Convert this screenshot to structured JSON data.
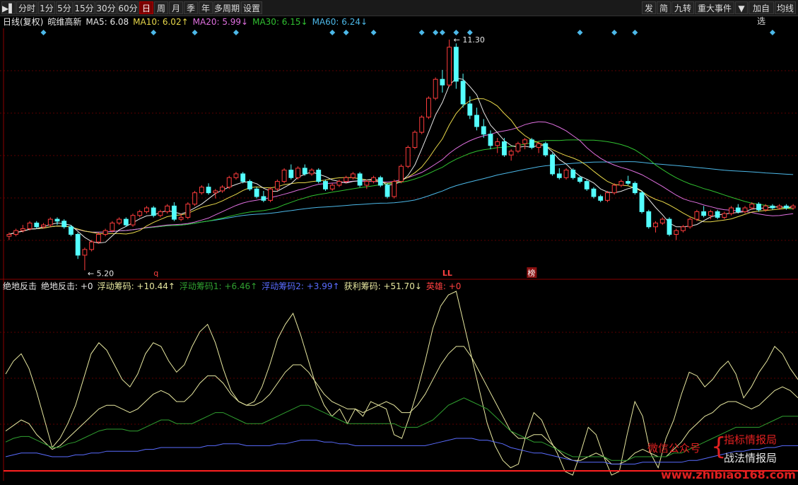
{
  "toolbar": {
    "left": [
      {
        "key": "play",
        "label": "▶▌"
      },
      {
        "key": "fenshi",
        "label": "分时"
      },
      {
        "key": "1f",
        "label": "1分"
      },
      {
        "key": "5f",
        "label": "5分"
      },
      {
        "key": "15f",
        "label": "15分"
      },
      {
        "key": "30f",
        "label": "30分"
      },
      {
        "key": "60f",
        "label": "60分"
      },
      {
        "key": "day",
        "label": "日",
        "active": true
      },
      {
        "key": "week",
        "label": "周"
      },
      {
        "key": "month",
        "label": "月"
      },
      {
        "key": "season",
        "label": "季"
      },
      {
        "key": "year",
        "label": "年"
      },
      {
        "key": "multi",
        "label": "多周期"
      },
      {
        "key": "settings",
        "label": "设置"
      }
    ],
    "right": [
      {
        "key": "fa",
        "label": "发"
      },
      {
        "key": "jian",
        "label": "简"
      },
      {
        "key": "jiuzhuan",
        "label": "九转"
      },
      {
        "key": "event",
        "label": "重大事件"
      },
      {
        "key": "dropdown",
        "label": "▼"
      },
      {
        "key": "addfav",
        "label": "加自选"
      },
      {
        "key": "junxian",
        "label": "均线"
      }
    ]
  },
  "ma_bar": {
    "prefix": "日线(复权)",
    "stock": "皖维高新",
    "items": [
      {
        "label": "MA5: 6.08",
        "color": "#e8e8e8"
      },
      {
        "label": "MA10: 6.02↑",
        "color": "#e8d84a"
      },
      {
        "label": "MA20: 5.99↓",
        "color": "#e070e0"
      },
      {
        "label": "MA30: 6.15↓",
        "color": "#30c030"
      },
      {
        "label": "MA60: 6.24↓",
        "color": "#4cb8e8"
      }
    ]
  },
  "indicator_bar": {
    "items": [
      {
        "label": "绝地反击",
        "color": "#e8e8e8"
      },
      {
        "label": "绝地反击: +0",
        "color": "#e8e8e8"
      },
      {
        "label": "浮动筹码: +10.44↑",
        "color": "#e8e8a0"
      },
      {
        "label": "浮动筹码1: +6.46↑",
        "color": "#30a030"
      },
      {
        "label": "浮动筹码2: +3.99↑",
        "color": "#5a6cff"
      },
      {
        "label": "获利筹码: +51.70↓",
        "color": "#e8e8a0"
      },
      {
        "label": "英雄: +0",
        "color": "#ff4040"
      }
    ]
  },
  "annotations": {
    "high_label": "11.30",
    "low_label": "5.20",
    "marker_q": "q",
    "marker_ll": "LL",
    "marker_bang": "榜"
  },
  "watermark": {
    "wechat": "微信公众号",
    "line1": "指标情报局",
    "line2": "战法情报局",
    "url": "www.zhibiao168.com"
  },
  "colors": {
    "up": "#ff3c3c",
    "down": "#54ffff",
    "ma5": "#e8e8e8",
    "ma10": "#e8d84a",
    "ma20": "#e070e0",
    "ma30": "#30c030",
    "ma60": "#4cb8e8",
    "grid": "#5a0000"
  },
  "chart_data": {
    "type": "candlestick",
    "title": "日线(复权) 皖维高新",
    "price_high": 11.3,
    "price_low": 5.2,
    "ylim": [
      5.0,
      11.6
    ],
    "candles": [
      [
        6.1,
        6.2,
        6.0,
        6.15
      ],
      [
        6.15,
        6.3,
        6.1,
        6.25
      ],
      [
        6.25,
        6.4,
        6.2,
        6.3
      ],
      [
        6.3,
        6.5,
        6.25,
        6.45
      ],
      [
        6.45,
        6.5,
        6.3,
        6.35
      ],
      [
        6.35,
        6.45,
        6.3,
        6.4
      ],
      [
        6.4,
        6.6,
        6.35,
        6.55
      ],
      [
        6.55,
        6.6,
        6.4,
        6.5
      ],
      [
        6.5,
        6.55,
        6.3,
        6.35
      ],
      [
        6.35,
        6.4,
        6.1,
        6.15
      ],
      [
        6.15,
        6.2,
        5.5,
        5.6
      ],
      [
        5.6,
        5.8,
        5.2,
        5.75
      ],
      [
        5.75,
        6.0,
        5.7,
        5.95
      ],
      [
        5.95,
        6.2,
        5.9,
        6.15
      ],
      [
        6.15,
        6.3,
        6.1,
        6.25
      ],
      [
        6.25,
        6.5,
        6.2,
        6.45
      ],
      [
        6.45,
        6.6,
        6.4,
        6.55
      ],
      [
        6.55,
        6.6,
        6.35,
        6.4
      ],
      [
        6.4,
        6.7,
        6.35,
        6.65
      ],
      [
        6.65,
        6.8,
        6.6,
        6.75
      ],
      [
        6.75,
        6.9,
        6.7,
        6.85
      ],
      [
        6.85,
        6.9,
        6.6,
        6.65
      ],
      [
        6.65,
        6.8,
        6.6,
        6.75
      ],
      [
        6.75,
        6.95,
        6.7,
        6.9
      ],
      [
        6.9,
        7.0,
        6.5,
        6.55
      ],
      [
        6.55,
        6.7,
        6.5,
        6.6
      ],
      [
        6.6,
        7.0,
        6.55,
        6.95
      ],
      [
        6.95,
        7.3,
        6.9,
        7.25
      ],
      [
        7.25,
        7.45,
        7.2,
        7.4
      ],
      [
        7.4,
        7.5,
        7.2,
        7.25
      ],
      [
        7.25,
        7.35,
        7.1,
        7.3
      ],
      [
        7.3,
        7.45,
        7.25,
        7.4
      ],
      [
        7.4,
        7.7,
        7.35,
        7.65
      ],
      [
        7.65,
        7.8,
        7.6,
        7.75
      ],
      [
        7.75,
        7.8,
        7.5,
        7.55
      ],
      [
        7.55,
        7.6,
        7.3,
        7.35
      ],
      [
        7.35,
        7.4,
        7.1,
        7.15
      ],
      [
        7.15,
        7.3,
        7.0,
        7.05
      ],
      [
        7.05,
        7.4,
        7.0,
        7.35
      ],
      [
        7.35,
        7.6,
        7.3,
        7.55
      ],
      [
        7.55,
        7.9,
        7.5,
        7.85
      ],
      [
        7.85,
        8.0,
        7.6,
        7.65
      ],
      [
        7.65,
        7.95,
        7.6,
        7.9
      ],
      [
        7.9,
        8.0,
        7.7,
        7.75
      ],
      [
        7.75,
        7.9,
        7.7,
        7.85
      ],
      [
        7.85,
        7.9,
        7.5,
        7.55
      ],
      [
        7.55,
        7.6,
        7.3,
        7.35
      ],
      [
        7.35,
        7.5,
        7.3,
        7.45
      ],
      [
        7.45,
        7.6,
        7.4,
        7.55
      ],
      [
        7.55,
        7.7,
        7.5,
        7.65
      ],
      [
        7.65,
        7.8,
        7.6,
        7.75
      ],
      [
        7.75,
        7.8,
        7.4,
        7.45
      ],
      [
        7.45,
        7.6,
        7.35,
        7.55
      ],
      [
        7.55,
        7.7,
        7.5,
        7.65
      ],
      [
        7.65,
        7.7,
        7.4,
        7.45
      ],
      [
        7.45,
        7.5,
        7.1,
        7.15
      ],
      [
        7.15,
        7.6,
        7.1,
        7.55
      ],
      [
        7.55,
        8.0,
        7.5,
        7.95
      ],
      [
        7.95,
        8.5,
        7.9,
        8.45
      ],
      [
        8.45,
        8.9,
        8.4,
        8.85
      ],
      [
        8.85,
        9.3,
        8.8,
        9.25
      ],
      [
        9.25,
        9.8,
        9.2,
        9.75
      ],
      [
        9.75,
        10.3,
        9.7,
        10.25
      ],
      [
        10.25,
        10.5,
        9.9,
        10.1
      ],
      [
        10.1,
        11.3,
        10.05,
        11.1
      ],
      [
        11.1,
        11.2,
        10.0,
        10.2
      ],
      [
        10.2,
        10.4,
        9.5,
        9.6
      ],
      [
        9.6,
        9.8,
        9.2,
        9.3
      ],
      [
        9.3,
        9.5,
        8.9,
        9.0
      ],
      [
        9.0,
        9.2,
        8.7,
        8.8
      ],
      [
        8.8,
        8.9,
        8.4,
        8.5
      ],
      [
        8.5,
        8.7,
        8.3,
        8.6
      ],
      [
        8.6,
        8.7,
        8.2,
        8.25
      ],
      [
        8.25,
        8.4,
        8.1,
        8.35
      ],
      [
        8.35,
        8.6,
        8.3,
        8.55
      ],
      [
        8.55,
        8.7,
        8.4,
        8.65
      ],
      [
        8.65,
        8.7,
        8.4,
        8.45
      ],
      [
        8.45,
        8.6,
        8.3,
        8.55
      ],
      [
        8.55,
        8.6,
        8.2,
        8.25
      ],
      [
        8.25,
        8.3,
        7.7,
        7.75
      ],
      [
        7.75,
        7.9,
        7.6,
        7.65
      ],
      [
        7.65,
        7.9,
        7.6,
        7.85
      ],
      [
        7.85,
        7.9,
        7.6,
        7.65
      ],
      [
        7.65,
        7.7,
        7.5,
        7.55
      ],
      [
        7.55,
        7.6,
        7.3,
        7.35
      ],
      [
        7.35,
        7.4,
        7.1,
        7.15
      ],
      [
        7.15,
        7.2,
        7.0,
        7.05
      ],
      [
        7.05,
        7.3,
        7.0,
        7.25
      ],
      [
        7.25,
        7.5,
        7.2,
        7.45
      ],
      [
        7.45,
        7.6,
        7.4,
        7.55
      ],
      [
        7.55,
        7.7,
        7.45,
        7.5
      ],
      [
        7.5,
        7.55,
        7.2,
        7.25
      ],
      [
        7.25,
        7.3,
        6.7,
        6.75
      ],
      [
        6.75,
        6.8,
        6.3,
        6.35
      ],
      [
        6.35,
        6.5,
        6.2,
        6.45
      ],
      [
        6.45,
        6.6,
        6.4,
        6.55
      ],
      [
        6.55,
        6.6,
        6.1,
        6.15
      ],
      [
        6.15,
        6.3,
        6.0,
        6.25
      ],
      [
        6.25,
        6.4,
        6.2,
        6.35
      ],
      [
        6.35,
        6.6,
        6.3,
        6.55
      ],
      [
        6.55,
        6.8,
        6.5,
        6.75
      ],
      [
        6.75,
        6.9,
        6.6,
        6.65
      ],
      [
        6.65,
        6.8,
        6.55,
        6.75
      ],
      [
        6.75,
        6.8,
        6.55,
        6.6
      ],
      [
        6.6,
        6.75,
        6.55,
        6.7
      ],
      [
        6.7,
        6.9,
        6.65,
        6.85
      ],
      [
        6.85,
        6.95,
        6.7,
        6.75
      ],
      [
        6.75,
        6.9,
        6.7,
        6.85
      ],
      [
        6.85,
        7.0,
        6.8,
        6.95
      ],
      [
        6.95,
        7.0,
        6.75,
        6.8
      ],
      [
        6.8,
        6.95,
        6.75,
        6.9
      ],
      [
        6.9,
        6.95,
        6.8,
        6.85
      ],
      [
        6.85,
        6.95,
        6.8,
        6.9
      ],
      [
        6.9,
        6.95,
        6.8,
        6.85
      ],
      [
        6.85,
        6.95,
        6.8,
        6.9
      ]
    ],
    "signals": [
      5,
      21,
      27,
      33,
      47,
      49,
      53,
      60,
      62,
      63,
      65,
      67,
      83,
      88,
      91,
      111
    ],
    "ind_ylim": [
      0,
      100
    ],
    "indicator_series": [
      {
        "name": "获利筹码",
        "color": "#e8e8a0",
        "values": [
          55,
          62,
          66,
          58,
          45,
          30,
          15,
          20,
          28,
          38,
          52,
          66,
          72,
          68,
          60,
          52,
          48,
          55,
          66,
          72,
          70,
          62,
          56,
          60,
          70,
          78,
          82,
          72,
          58,
          46,
          40,
          38,
          40,
          48,
          60,
          74,
          82,
          88,
          76,
          62,
          48,
          38,
          32,
          36,
          28,
          36,
          32,
          40,
          38,
          36,
          22,
          20,
          32,
          46,
          62,
          80,
          92,
          98,
          100,
          82,
          64,
          46,
          28,
          16,
          8,
          4,
          6,
          22,
          34,
          30,
          20,
          12,
          2,
          0,
          12,
          26,
          22,
          10,
          0,
          2,
          22,
          40,
          32,
          12,
          4,
          20,
          30,
          44,
          56,
          54,
          48,
          52,
          58,
          62,
          55,
          42,
          48,
          56,
          62,
          70,
          66,
          58,
          52
        ]
      },
      {
        "name": "浮动筹码",
        "color": "#e8e8a0",
        "values": [
          24,
          27,
          30,
          28,
          22,
          18,
          14,
          16,
          20,
          24,
          28,
          32,
          36,
          38,
          38,
          36,
          34,
          36,
          40,
          44,
          46,
          44,
          40,
          40,
          44,
          50,
          54,
          54,
          50,
          44,
          40,
          38,
          38,
          40,
          44,
          50,
          56,
          60,
          60,
          56,
          50,
          44,
          40,
          38,
          36,
          36,
          34,
          36,
          38,
          40,
          38,
          34,
          34,
          38,
          44,
          52,
          60,
          66,
          70,
          70,
          64,
          56,
          48,
          40,
          32,
          24,
          20,
          20,
          22,
          22,
          18,
          14,
          10,
          8,
          8,
          10,
          12,
          10,
          6,
          6,
          8,
          12,
          14,
          12,
          10,
          10,
          14,
          18,
          24,
          28,
          32,
          34,
          38,
          40,
          40,
          38,
          36,
          38,
          42,
          46,
          48,
          46,
          42
        ]
      },
      {
        "name": "浮动筹码1",
        "color": "#30a030",
        "values": [
          18,
          20,
          21,
          21,
          19,
          17,
          15,
          15,
          17,
          18,
          20,
          22,
          24,
          25,
          25,
          25,
          24,
          24,
          26,
          28,
          30,
          30,
          28,
          28,
          28,
          30,
          32,
          34,
          34,
          32,
          30,
          28,
          28,
          28,
          30,
          32,
          34,
          36,
          38,
          38,
          36,
          34,
          32,
          30,
          28,
          28,
          28,
          28,
          28,
          28,
          28,
          26,
          26,
          26,
          28,
          30,
          34,
          38,
          40,
          42,
          40,
          38,
          36,
          32,
          28,
          24,
          22,
          20,
          18,
          18,
          16,
          14,
          12,
          10,
          10,
          10,
          10,
          10,
          8,
          8,
          8,
          10,
          10,
          10,
          10,
          10,
          12,
          12,
          14,
          16,
          18,
          20,
          22,
          24,
          26,
          26,
          26,
          26,
          28,
          30,
          32,
          32,
          32
        ]
      },
      {
        "name": "浮动筹码2",
        "color": "#5a6cff",
        "values": [
          10,
          11,
          12,
          12,
          12,
          11,
          10,
          10,
          10,
          11,
          11,
          12,
          12,
          13,
          13,
          13,
          13,
          13,
          14,
          14,
          15,
          15,
          15,
          15,
          15,
          15,
          16,
          16,
          17,
          17,
          17,
          16,
          16,
          16,
          16,
          17,
          17,
          18,
          19,
          19,
          19,
          18,
          18,
          17,
          17,
          16,
          16,
          16,
          16,
          16,
          16,
          16,
          16,
          16,
          16,
          17,
          18,
          19,
          20,
          20,
          20,
          19,
          19,
          18,
          17,
          15,
          14,
          13,
          12,
          12,
          11,
          10,
          9,
          8,
          7,
          7,
          7,
          7,
          6,
          6,
          6,
          6,
          7,
          7,
          7,
          7,
          7,
          7,
          8,
          8,
          9,
          10,
          11,
          12,
          13,
          13,
          14,
          14,
          15,
          15,
          16,
          16,
          16
        ]
      },
      {
        "name": "英雄",
        "color": "#ff2020",
        "values": [
          1,
          1,
          1,
          1,
          1,
          1,
          1,
          1,
          1,
          1,
          1,
          1,
          1,
          1,
          1,
          1,
          1,
          1,
          1,
          1,
          1,
          1,
          1,
          1,
          1,
          1,
          1,
          1,
          1,
          1,
          1,
          1,
          1,
          1,
          1,
          1,
          1,
          1,
          1,
          1,
          1,
          1,
          1,
          1,
          1,
          1,
          1,
          1,
          1,
          1,
          1,
          1,
          1,
          1,
          1,
          1,
          1,
          1,
          1,
          1,
          1,
          1,
          1,
          1,
          1,
          1,
          1,
          1,
          1,
          1,
          1,
          1,
          1,
          1,
          1,
          1,
          1,
          1,
          1,
          1,
          1,
          1,
          1,
          1,
          1,
          1,
          1,
          1,
          1,
          1,
          1,
          1,
          1,
          1,
          1,
          1,
          1,
          1,
          1,
          1,
          1,
          1,
          1
        ]
      }
    ]
  }
}
